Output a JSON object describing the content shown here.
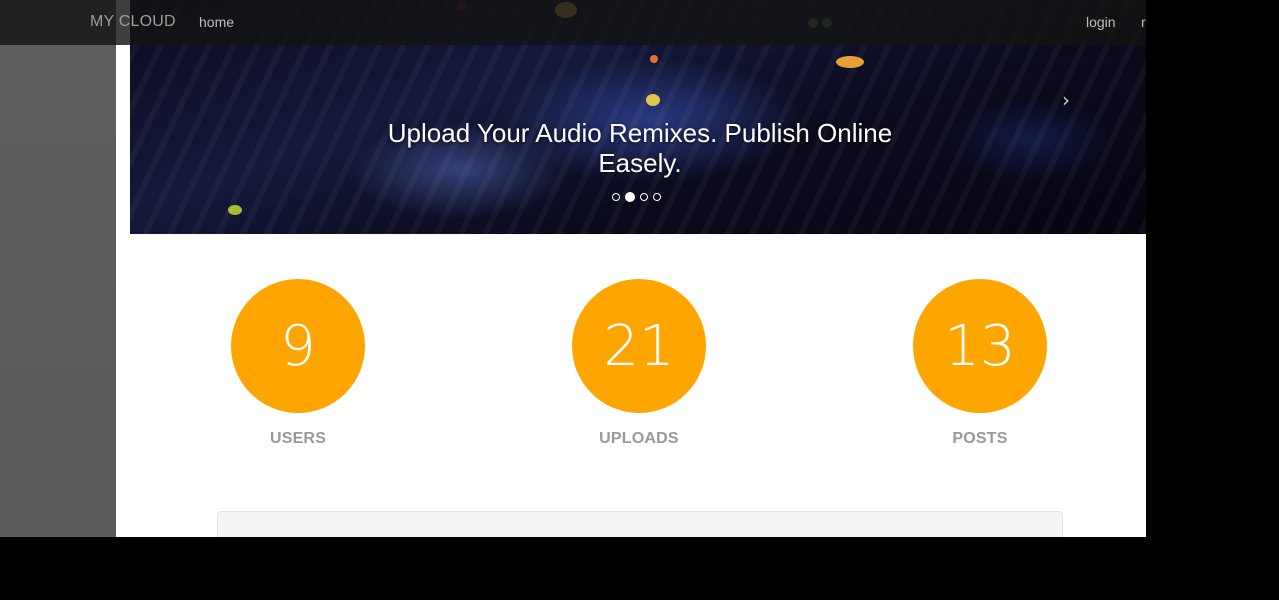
{
  "navbar": {
    "brand": "MY CLOUD",
    "links": {
      "home": "home",
      "login": "login",
      "register": "r"
    }
  },
  "carousel": {
    "caption": "Upload Your Audio Remixes. Publish Online Easely.",
    "indicator_count": 4,
    "active_index": 1,
    "next_icon": "chevron-right-icon"
  },
  "stats": [
    {
      "value": "9",
      "label": "USERS"
    },
    {
      "value": "21",
      "label": "UPLOADS"
    },
    {
      "value": "13",
      "label": "POSTS"
    }
  ],
  "colors": {
    "accent": "#ffa500",
    "navbar": "#141414",
    "stat_label": "#999999",
    "side_strip": "#5e5e5e"
  }
}
